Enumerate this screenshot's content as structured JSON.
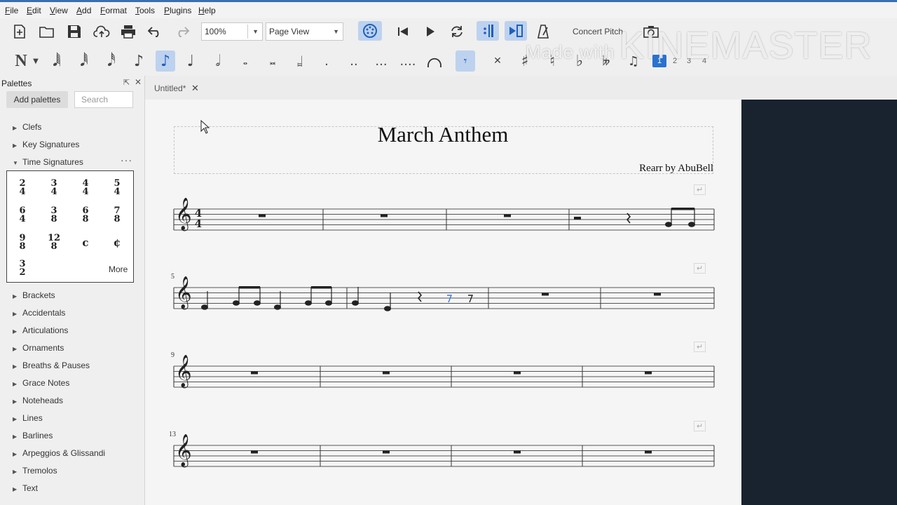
{
  "menu": [
    "File",
    "Edit",
    "View",
    "Add",
    "Format",
    "Tools",
    "Plugins",
    "Help"
  ],
  "toolbar": {
    "zoom": "100%",
    "view_mode": "Page View",
    "concert_pitch": "Concert Pitch",
    "voices": [
      "1",
      "2",
      "3",
      "4"
    ]
  },
  "palettes": {
    "header": "Palettes",
    "add_button": "Add palettes",
    "search_placeholder": "Search",
    "items_top": [
      "Clefs",
      "Key Signatures"
    ],
    "expanded": "Time Signatures",
    "more": "More",
    "time_signatures": [
      [
        "2",
        "4"
      ],
      [
        "3",
        "4"
      ],
      [
        "4",
        "4"
      ],
      [
        "5",
        "4"
      ],
      [
        "6",
        "4"
      ],
      [
        "3",
        "8"
      ],
      [
        "6",
        "8"
      ],
      [
        "7",
        "8"
      ],
      [
        "9",
        "8"
      ],
      [
        "12",
        "8"
      ],
      [
        "c",
        ""
      ],
      [
        "¢",
        ""
      ],
      [
        "3",
        "2"
      ]
    ],
    "items_bottom": [
      "Brackets",
      "Accidentals",
      "Articulations",
      "Ornaments",
      "Breaths & Pauses",
      "Grace Notes",
      "Noteheads",
      "Lines",
      "Barlines",
      "Arpeggios & Glissandi",
      "Tremolos",
      "Text"
    ]
  },
  "tab": {
    "label": "Untitled*",
    "close": "✕"
  },
  "score": {
    "title": "March Anthem",
    "composer": "Rearr by AbuBell",
    "time_signature": [
      "4",
      "4"
    ],
    "measure_numbers": [
      "5",
      "9",
      "13"
    ]
  },
  "watermark": {
    "prefix": "Made with",
    "brand": "KINEMASTER"
  }
}
